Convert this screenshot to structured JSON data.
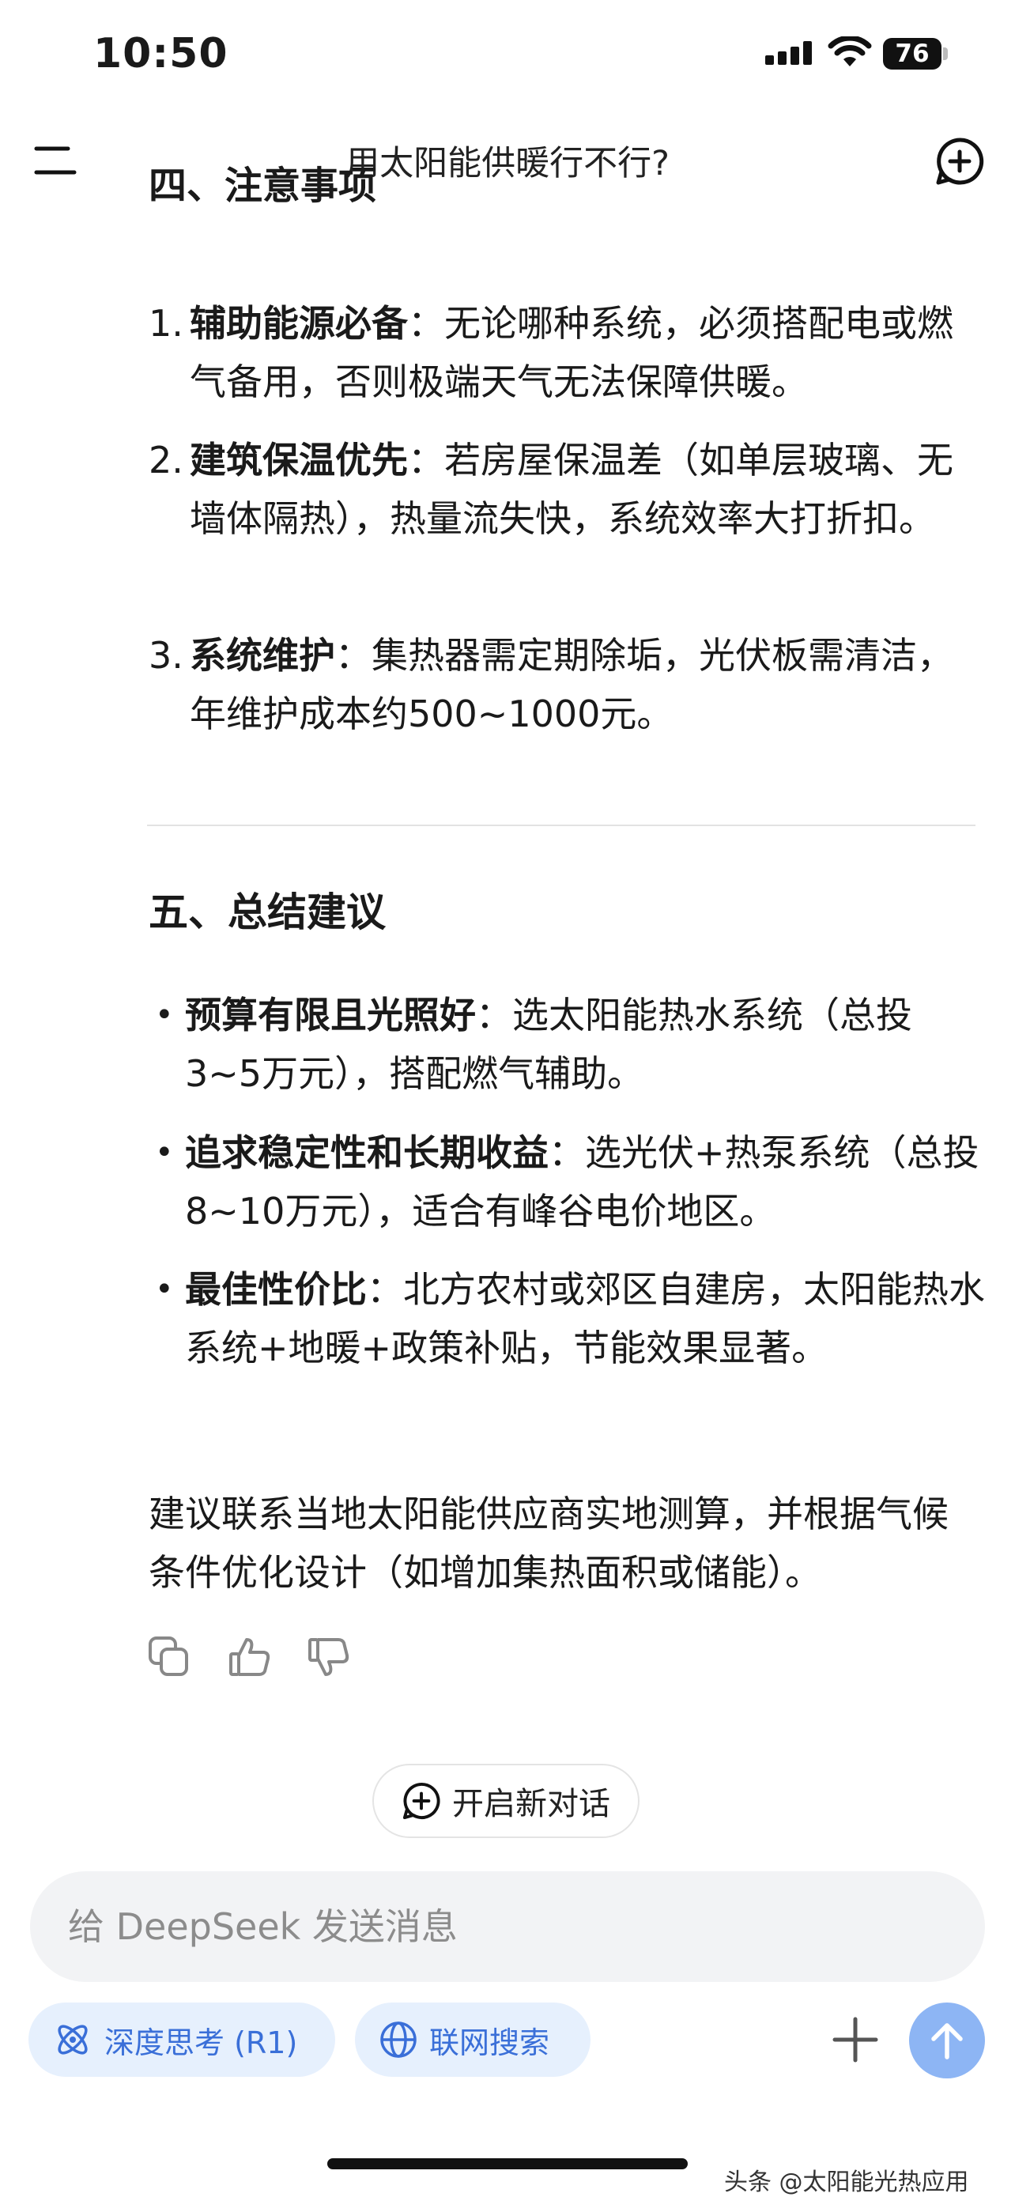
{
  "status_bar": {
    "time": "10:50",
    "battery": "76"
  },
  "header": {
    "title": "用太阳能供暖行不行?"
  },
  "section4": {
    "heading": "四、注意事项",
    "items": [
      {
        "num": "1.",
        "title": "辅助能源必备",
        "text": "：无论哪种系统，必须搭配电或燃气备用，否则极端天气无法保障供暖。"
      },
      {
        "num": "2.",
        "title": "建筑保温优先",
        "text": "：若房屋保温差（如单层玻璃、无墙体隔热），热量流失快，系统效率大打折扣。"
      },
      {
        "num": "3.",
        "title": "系统维护",
        "text": "：集热器需定期除垢，光伏板需清洁，年维护成本约500~1000元。"
      }
    ]
  },
  "section5": {
    "heading": "五、总结建议",
    "bullet_char": "•",
    "items": [
      {
        "title": "预算有限且光照好",
        "text": "：选太阳能热水系统（总投3~5万元），搭配燃气辅助。"
      },
      {
        "title": "追求稳定性和长期收益",
        "text": "：选光伏+热泵系统（总投8~10万元），适合有峰谷电价地区。"
      },
      {
        "title": "最佳性价比",
        "text": "：北方农村或郊区自建房，太阳能热水系统+地暖+政策补贴，节能效果显著。"
      }
    ]
  },
  "closing": "建议联系当地太阳能供应商实地测算，并根据气候条件优化设计（如增加集热面积或储能）。",
  "actions": {
    "copy_icon": "copy-icon",
    "like_icon": "thumbs-up-icon",
    "dislike_icon": "thumbs-down-icon"
  },
  "new_chat": {
    "label": "开启新对话"
  },
  "input": {
    "placeholder": "给 DeepSeek 发送消息"
  },
  "toggles": {
    "deep_think": "深度思考 (R1)",
    "web_search": "联网搜索"
  },
  "watermark": "头条 @太阳能光热应用",
  "colors": {
    "accent": "#3a6fd8",
    "pill_bg": "#e6f0fd",
    "send_bg": "#8db5f4"
  }
}
